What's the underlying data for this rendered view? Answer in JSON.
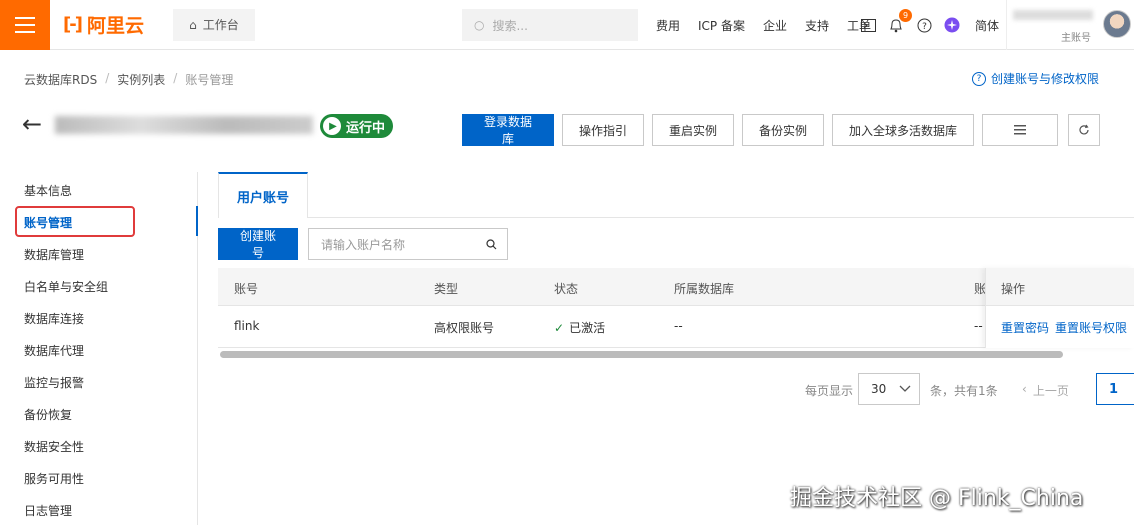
{
  "header": {
    "logo_text": "阿里云",
    "workbench_label": "工作台",
    "search_placeholder": "搜索...",
    "nav": [
      "费用",
      "ICP 备案",
      "企业",
      "支持",
      "工单"
    ],
    "notification_count": "9",
    "language": "简体",
    "user_role": "主账号"
  },
  "breadcrumb": {
    "items": [
      "云数据库RDS",
      "实例列表",
      "账号管理"
    ]
  },
  "help_link": "创建账号与修改权限",
  "instance": {
    "status": "运行中"
  },
  "actions": {
    "login_db": "登录数据库",
    "guide": "操作指引",
    "restart": "重启实例",
    "backup": "备份实例",
    "global": "加入全球多活数据库"
  },
  "sidebar": {
    "items": [
      "基本信息",
      "账号管理",
      "数据库管理",
      "白名单与安全组",
      "数据库连接",
      "数据库代理",
      "监控与报警",
      "备份恢复",
      "数据安全性",
      "服务可用性",
      "日志管理"
    ]
  },
  "tab": {
    "label": "用户账号"
  },
  "toolbar": {
    "create_label": "创建账号",
    "search_placeholder": "请输入账户名称"
  },
  "table": {
    "columns": [
      "账号",
      "类型",
      "状态",
      "所属数据库",
      "账",
      "操作"
    ],
    "rows": [
      {
        "account": "flink",
        "type": "高权限账号",
        "status": "已激活",
        "database": "--",
        "extra": "--",
        "op1": "重置密码",
        "op2": "重置账号权限"
      }
    ]
  },
  "pagination": {
    "per_page_label": "每页显示",
    "page_size": "30",
    "total_label": "条，共有1条",
    "prev_label": "上一页",
    "current_page": "1"
  },
  "watermark": "掘金技术社区 @ Flink_China",
  "colors": {
    "brand": "#ff6a00",
    "primary": "#0064c8",
    "running": "#1e8a3a"
  }
}
